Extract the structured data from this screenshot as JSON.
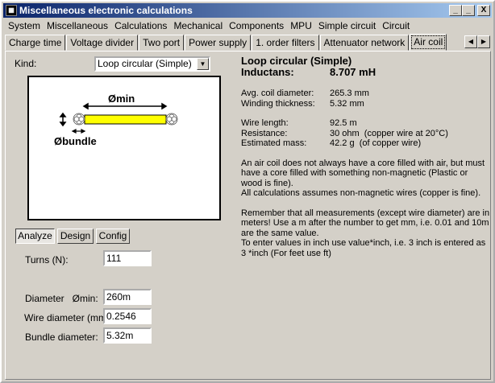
{
  "window": {
    "title": "Miscellaneous electronic calculations",
    "minimize": "_",
    "maximize": "□",
    "close": "X"
  },
  "menu": [
    "System",
    "Miscellaneous",
    "Calculations",
    "Mechanical",
    "Components",
    "MPU",
    "Simple circuit",
    "Circuit"
  ],
  "tabs": [
    "Charge time",
    "Voltage divider",
    "Two port",
    "Power supply",
    "1. order filters",
    "Attenuator network",
    "Air coil"
  ],
  "active_tab": "Air coil",
  "kind": {
    "label": "Kind:",
    "value": "Loop circular (Simple)"
  },
  "diagram": {
    "dia_min": "Ømin",
    "dia_bundle": "Øbundle",
    "coil_color": "#ffff00"
  },
  "mode_buttons": [
    "Analyze",
    "Design",
    "Config"
  ],
  "inputs": {
    "turns": {
      "label": "Turns (N):",
      "value": "111"
    },
    "diameter": {
      "label": "Diameter   Ømin:",
      "value": "260m"
    },
    "wire": {
      "label": "Wire diameter (mm):",
      "value": "0.2546"
    },
    "bundle": {
      "label": "Bundle diameter:",
      "value": "5.32m"
    }
  },
  "results": {
    "title": "Loop circular (Simple)",
    "inductance_label": "Inductans:",
    "inductance_value": "8.707 mH",
    "rows1": [
      [
        "Avg. coil diameter:",
        "265.3 mm"
      ],
      [
        "Winding thickness:",
        "5.32 mm"
      ]
    ],
    "rows2": [
      [
        "Wire length:",
        "92.5 m"
      ],
      [
        "Resistance:",
        "30 ohm  (copper wire at 20°C)"
      ],
      [
        "Estimated mass:",
        "42.2 g  (of copper wire)"
      ]
    ],
    "note1": "An air coil does not always have a core filled with air, but must have a core filled with something non-magnetic (Plastic or wood is fine).",
    "note2": "All calculations assumes non-magnetic wires (copper is fine).",
    "note3": "Remember that all measurements (except wire diameter) are in meters! Use a m after the number to get mm, i.e. 0.01 and 10m are the same value.",
    "note4": "To enter values in inch use value*inch, i.e. 3 inch is entered as 3 *inch (For feet use ft)"
  }
}
